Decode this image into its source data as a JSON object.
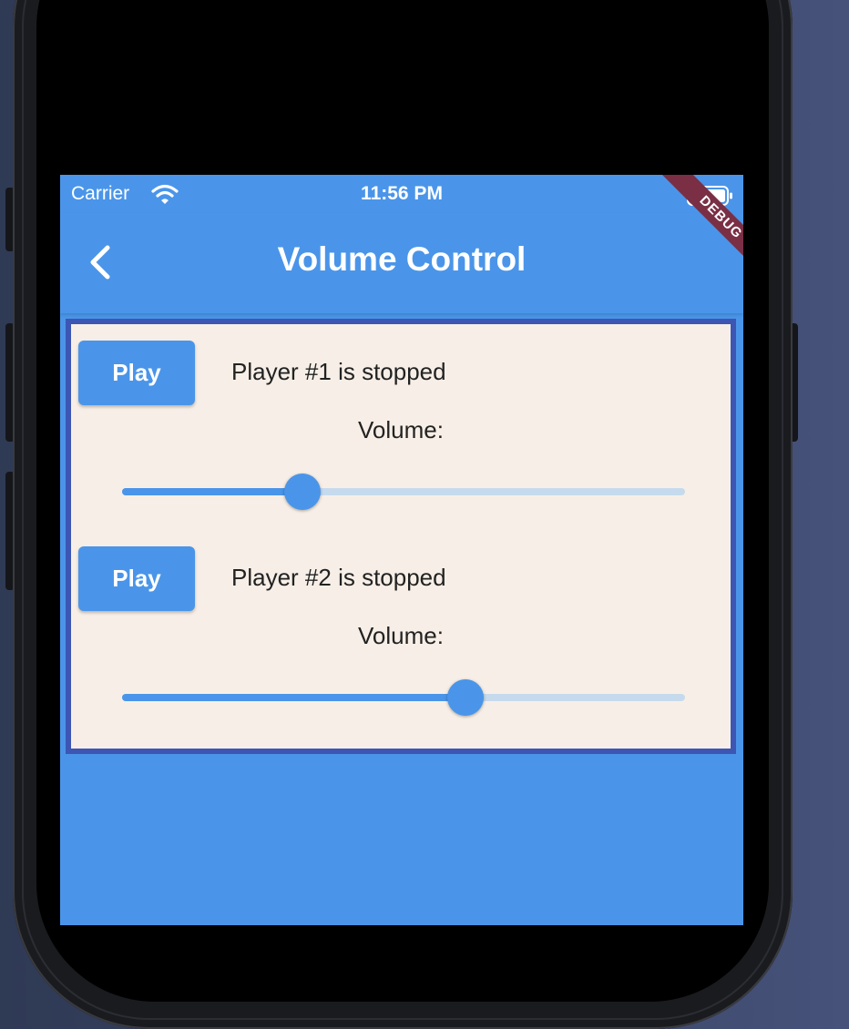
{
  "status_bar": {
    "carrier": "Carrier",
    "time": "11:56 PM",
    "wifi_icon": "wifi-icon",
    "battery_icon": "battery-icon"
  },
  "debug_banner": "DEBUG",
  "app_bar": {
    "title": "Volume Control",
    "back_icon": "chevron-left-icon"
  },
  "players": [
    {
      "button_label": "Play",
      "status": "Player #1 is stopped",
      "volume_label": "Volume:",
      "volume": 0.32
    },
    {
      "button_label": "Play",
      "status": "Player #2 is stopped",
      "volume_label": "Volume:",
      "volume": 0.61
    }
  ],
  "colors": {
    "primary": "#4a95e9",
    "panel_background": "#f7efe7",
    "panel_border": "#3d56b3",
    "track_inactive": "#c6daed",
    "debug_banner": "#7a2f45"
  }
}
